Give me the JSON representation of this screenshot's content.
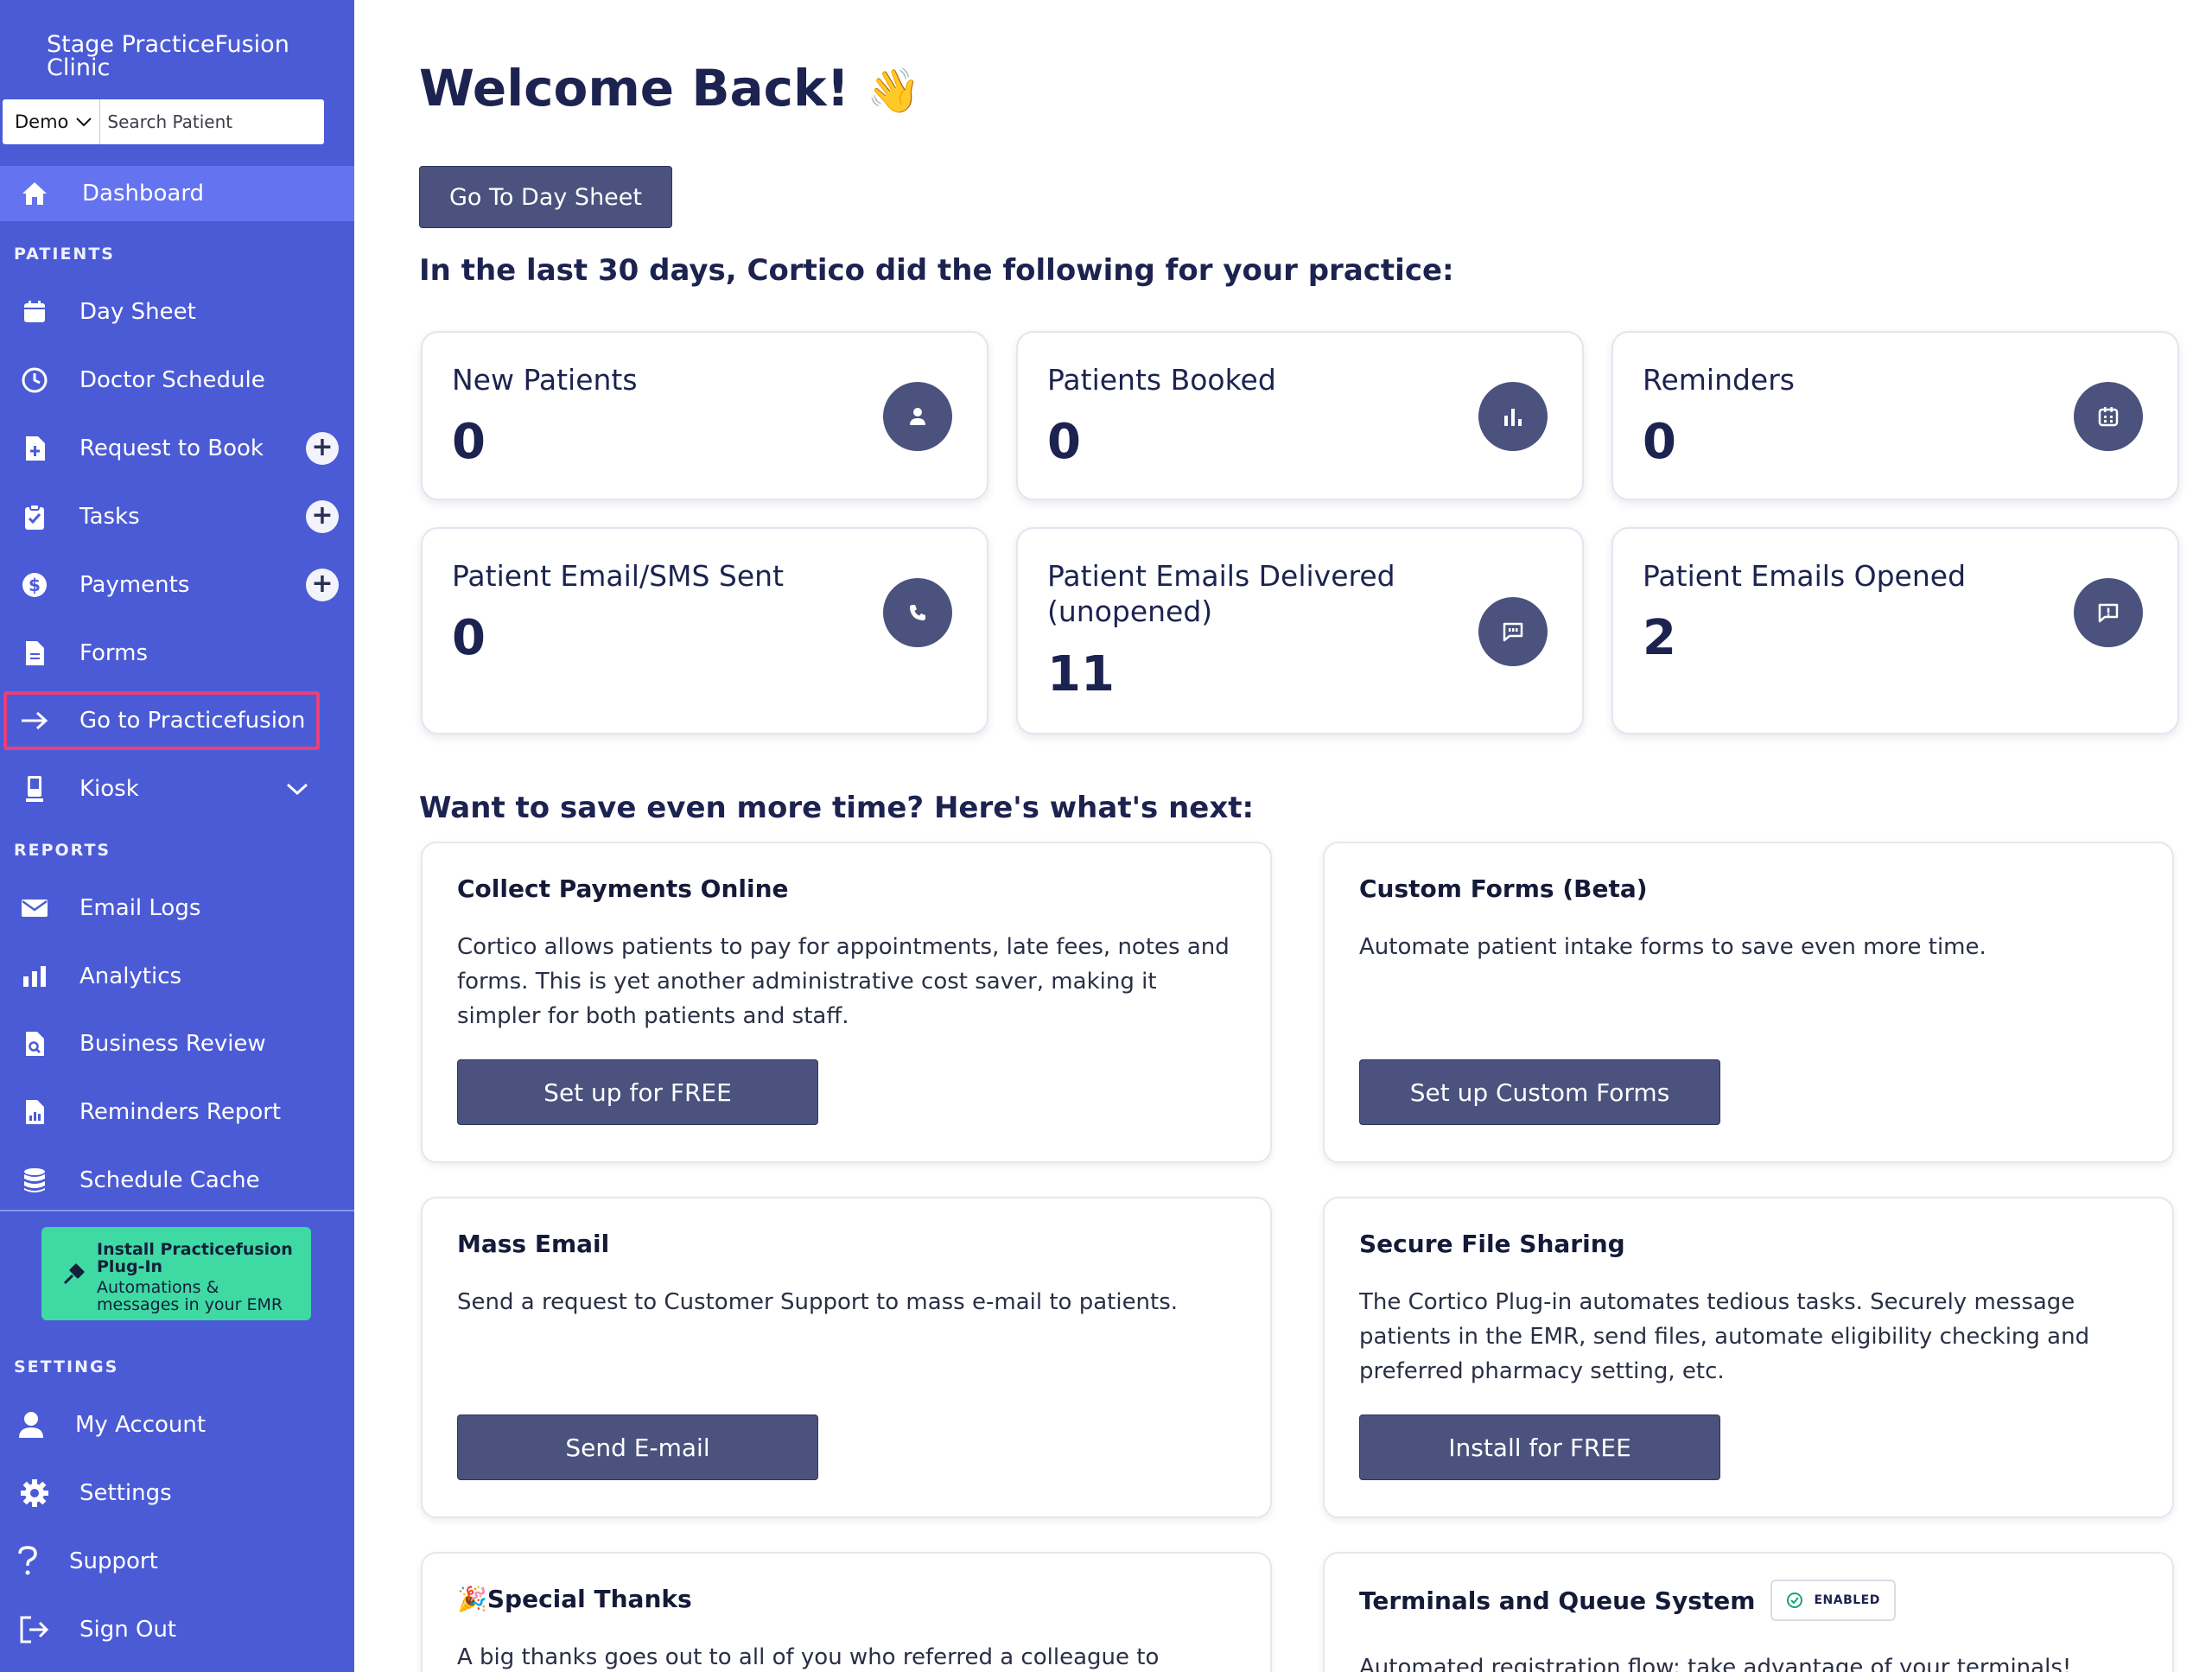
{
  "sidebar": {
    "clinic_name": "Stage PracticeFusion Clinic",
    "search": {
      "mode": "Demo",
      "placeholder": "Search Patient"
    },
    "dashboard": "Dashboard",
    "sections": {
      "patients": "PATIENTS",
      "reports": "REPORTS",
      "settings": "SETTINGS"
    },
    "patients_items": [
      "Day Sheet",
      "Doctor Schedule",
      "Request to Book",
      "Tasks",
      "Payments",
      "Forms",
      "Go to Practicefusion",
      "Kiosk"
    ],
    "reports_items": [
      "Email Logs",
      "Analytics",
      "Business Review",
      "Reminders Report",
      "Schedule Cache"
    ],
    "plugin": {
      "title": "Install Practicefusion Plug-In",
      "subtitle": "Automations & messages in your EMR"
    },
    "settings_items": [
      "My Account",
      "Settings",
      "Support",
      "Sign Out"
    ],
    "highlight_color": "#ea3f78",
    "bg_color": "#4b5bd6"
  },
  "main": {
    "title": "Welcome Back!",
    "title_emoji": "👋",
    "day_sheet_button": "Go To Day Sheet",
    "stats_heading": "In the last 30 days, Cortico did the following for your practice:",
    "stats": [
      {
        "label": "New Patients",
        "value": "0",
        "icon": "user-icon"
      },
      {
        "label": "Patients Booked",
        "value": "0",
        "icon": "bar-chart-icon"
      },
      {
        "label": "Reminders",
        "value": "0",
        "icon": "calendar-icon"
      },
      {
        "label": "Patient Email/SMS Sent",
        "value": "0",
        "icon": "phone-icon"
      },
      {
        "label": "Patient Emails Delivered (unopened)",
        "value": "11",
        "icon": "message-icon"
      },
      {
        "label": "Patient Emails Opened",
        "value": "2",
        "icon": "message-alert-icon"
      }
    ],
    "next_heading": "Want to save even more time? Here's what's next:",
    "cards": [
      {
        "title": "Collect Payments Online",
        "text": "Cortico allows patients to pay for appointments, late fees, notes and forms. This is yet another administrative cost saver, making it simpler for both patients and staff.",
        "button": "Set up for FREE"
      },
      {
        "title": "Custom Forms (Beta)",
        "text": "Automate patient intake forms to save even more time.",
        "button": "Set up Custom Forms"
      },
      {
        "title": "Mass Email",
        "text": "Send a request to Customer Support to mass e-mail to patients.",
        "button": "Send E-mail"
      },
      {
        "title": "Secure File Sharing",
        "text": "The Cortico Plug-in automates tedious tasks. Securely message patients in the EMR, send files, automate eligibility checking and preferred pharmacy setting, etc.",
        "button": "Install for FREE"
      },
      {
        "title": "Special Thanks",
        "title_emoji": "🎉",
        "text": "A big thanks goes out to all of you who referred a colleague to Cortico this year - we're so grateful for your support! If you know anyone else"
      },
      {
        "title": "Terminals and Queue System",
        "badge": "ENABLED",
        "text": "Automated registration flow: take advantage of your terminals!"
      }
    ]
  }
}
